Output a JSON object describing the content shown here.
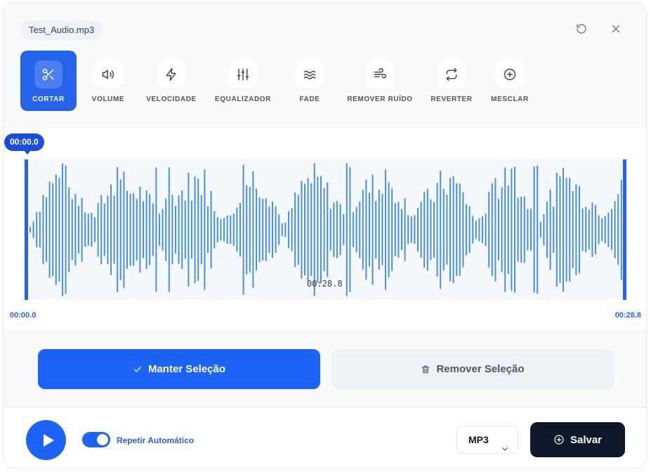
{
  "file": {
    "name": "Test_Audio.mp3"
  },
  "header": {
    "icons": [
      "reset-icon",
      "close-icon"
    ]
  },
  "tools": [
    {
      "label": "CORTAR",
      "icon": "scissors-icon",
      "active": true
    },
    {
      "label": "VOLUME",
      "icon": "volume-icon",
      "active": false
    },
    {
      "label": "VELOCIDADE",
      "icon": "lightning-icon",
      "active": false
    },
    {
      "label": "EQUALIZADOR",
      "icon": "sliders-icon",
      "active": false
    },
    {
      "label": "FADE",
      "icon": "waves-icon",
      "active": false
    },
    {
      "label": "REMOVER RUÍDO",
      "icon": "wind-icon",
      "active": false
    },
    {
      "label": "REVERTER",
      "icon": "repeat-icon",
      "active": false
    },
    {
      "label": "MESCLAR",
      "icon": "plus-circle-icon",
      "active": false
    }
  ],
  "waveform": {
    "playhead_time": "00:00.0",
    "center_time": "00:28.8",
    "range_start": "00:00.0",
    "range_end": "00:28.8",
    "color": "#4a90e2"
  },
  "actions": {
    "keep_label": "Manter Seleção",
    "remove_label": "Remover Seleção"
  },
  "footer": {
    "repeat_label": "Repetir Automático",
    "repeat_enabled": true,
    "format_value": "MP3",
    "save_label": "Salvar"
  },
  "colors": {
    "accent": "#1d63f5",
    "dark": "#0f172a"
  }
}
